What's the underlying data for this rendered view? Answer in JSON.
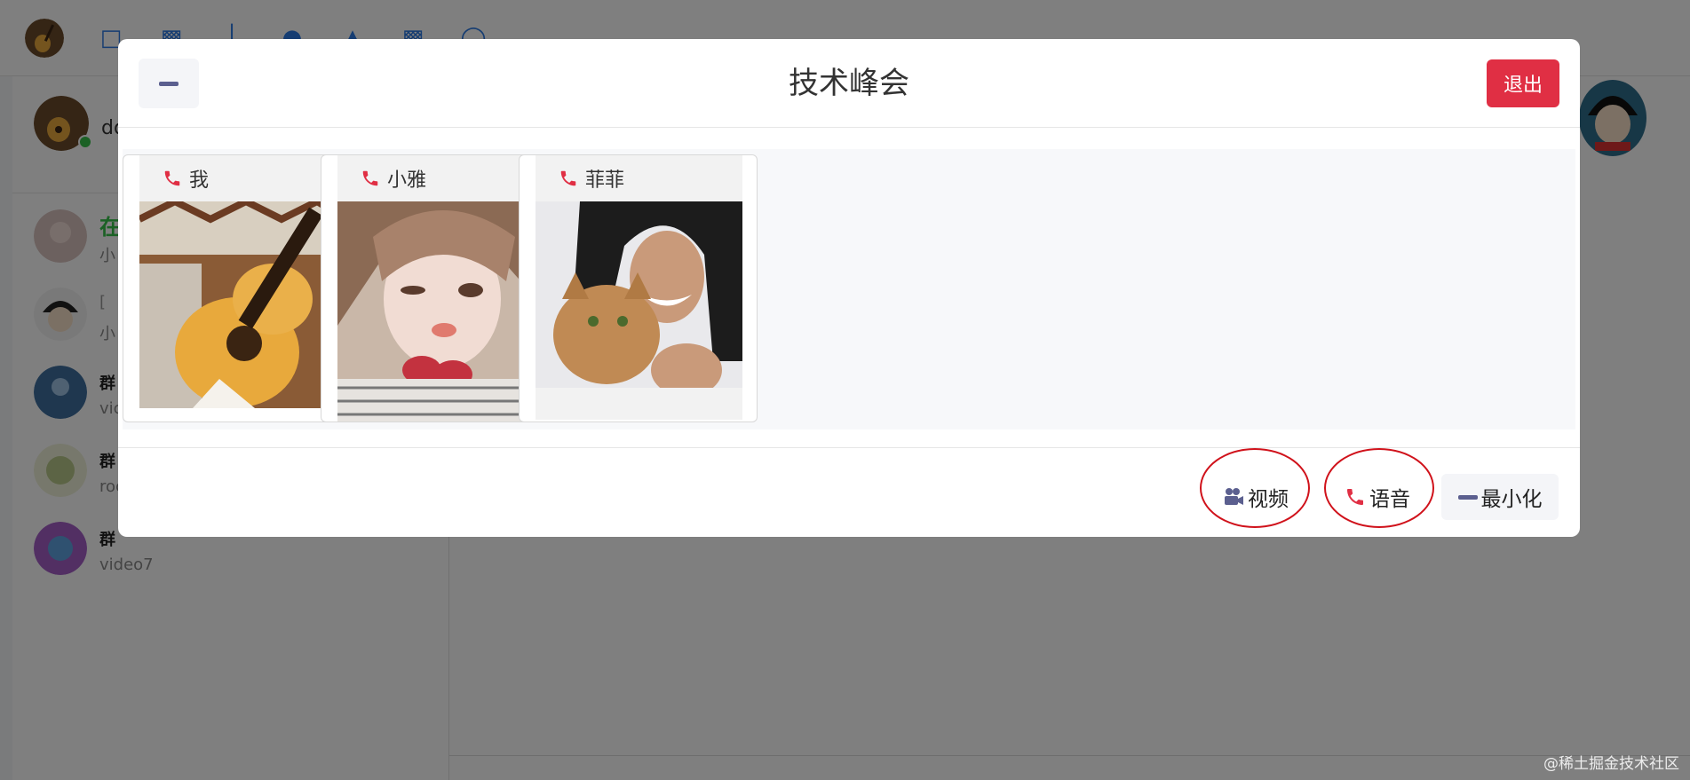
{
  "app": {
    "me_name_partial": "do",
    "conversations": [
      {
        "title": "在",
        "subtitle": "小",
        "style": "green"
      },
      {
        "title": "[",
        "subtitle": "小",
        "style": "grey"
      },
      {
        "title": "群",
        "subtitle": "vic",
        "style": "bold"
      },
      {
        "title": "群",
        "subtitle": "roc",
        "style": "bold"
      },
      {
        "title": "群",
        "subtitle": "video7",
        "style": "bold"
      }
    ]
  },
  "modal": {
    "title": "技术峰会",
    "exit_label": "退出",
    "participants": [
      {
        "name": "我"
      },
      {
        "name": "小雅"
      },
      {
        "name": "菲菲"
      }
    ],
    "footer": {
      "video_label": "视频",
      "voice_label": "语音",
      "minimize_label": "最小化"
    }
  },
  "watermark": "@稀土掘金技术社区",
  "colors": {
    "danger": "#e02f44",
    "accent": "#5b5f8f",
    "online": "#37c24a",
    "annotation_ring": "#d0121b"
  },
  "icons": [
    "minimize-icon",
    "phone-icon",
    "video-camera-icon"
  ]
}
